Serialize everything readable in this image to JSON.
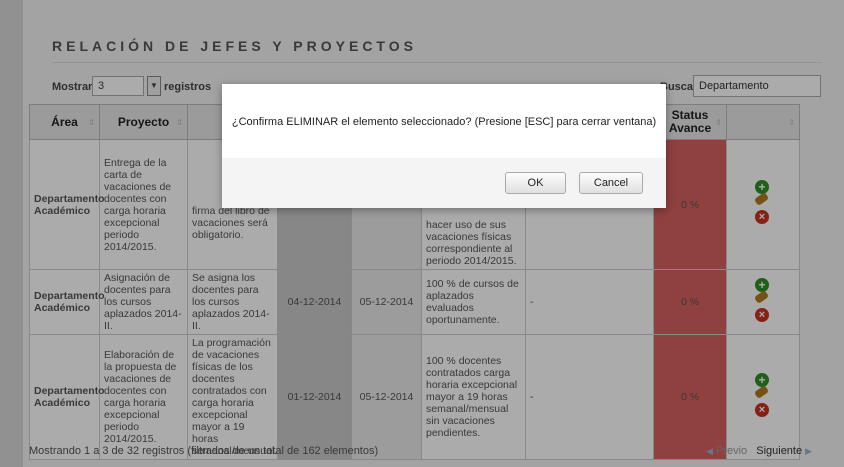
{
  "title": "RELACIÓN DE JEFES Y PROYECTOS",
  "controls": {
    "show_label": "Mostrar",
    "page_length": "3",
    "records_label": "registros",
    "search_label": "Buscar:",
    "search_value": "Departamento"
  },
  "table": {
    "headers": [
      "Área",
      "Proyecto",
      "",
      "",
      "",
      "",
      "",
      "Status Avance",
      ""
    ],
    "rows": [
      {
        "area": "Departamento Académico",
        "proyecto": "Entrega de la carta de vacaciones de docentes con carga horaria excepcional periodo 2014/2015.",
        "descripcion": "firma del libro de vacaciones será obligatorio.",
        "fecha_inicio": "",
        "fecha_fin": "",
        "meta": "hacer uso de sus vacaciones físicas correspondiente al periodo 2014/2015.",
        "obs": "",
        "status": "0 %"
      },
      {
        "area": "Departamento Académico",
        "proyecto": "Asignación de docentes para los cursos aplazados 2014-II.",
        "descripcion": "Se asigna los docentes para los cursos aplazados 2014-II.",
        "fecha_inicio": "04-12-2014",
        "fecha_fin": "05-12-2014",
        "meta": "100 % de cursos de aplazados evaluados oportunamente.",
        "obs": "-",
        "status": "0 %"
      },
      {
        "area": "Departamento Académico",
        "proyecto": "Elaboración de la propuesta de vacaciones de docentes con carga horaria excepcional periodo 2014/2015.",
        "descripcion": "La programación de vacaciones físicas de los docentes contratados con carga horaria excepcional mayor a 19 horas semanal/mensual.",
        "fecha_inicio": "01-12-2014",
        "fecha_fin": "05-12-2014",
        "meta": "100 % docentes contratados carga horaria excepcional mayor a 19 horas semanal/mensual sin vacaciones pendientes.",
        "obs": "-",
        "status": "0 %"
      }
    ]
  },
  "footer": {
    "info": "Mostrando 1 a 3 de 32 registros (filtrados de un total de 162 elementos)",
    "prev": "Previo",
    "next": "Siguiente"
  },
  "dialog": {
    "message": "¿Confirma ELIMINAR el elemento seleccionado? (Presione [ESC] para cerrar ventana)",
    "ok": "OK",
    "cancel": "Cancel"
  },
  "colors": {
    "status_bg": "#d6615e",
    "add_icon": "#2f8f23",
    "delete_icon": "#c6341f"
  }
}
